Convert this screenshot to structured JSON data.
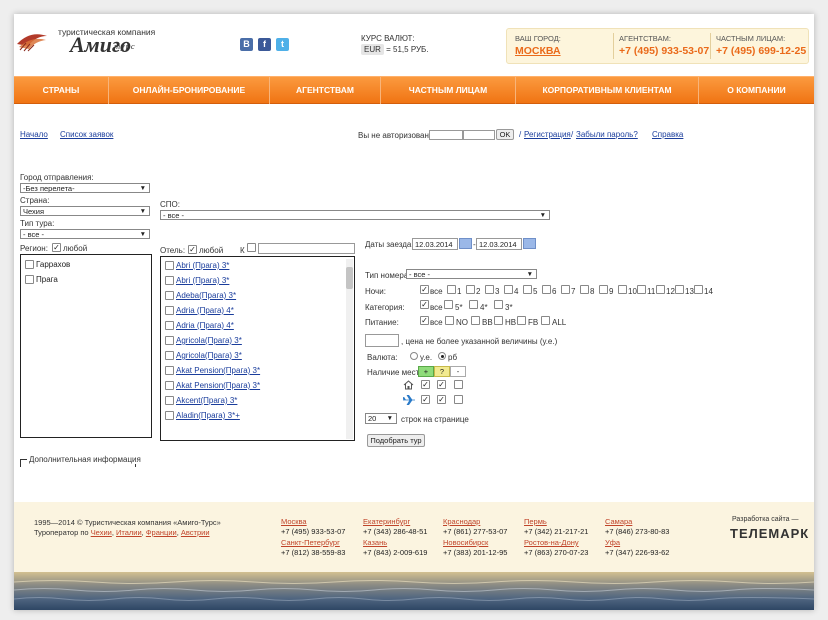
{
  "header": {
    "logo_top": "туристическая компания",
    "logo_main": "Амиго",
    "logo_sub": "турс",
    "social": [
      {
        "icon": "vk-icon",
        "text": "B",
        "color": "#4a6ea8"
      },
      {
        "icon": "facebook-icon",
        "text": "f",
        "color": "#3b5998"
      },
      {
        "icon": "twitter-icon",
        "text": "t",
        "color": "#4fb0e8"
      }
    ],
    "rate_title": "КУРС ВАЛЮТ:",
    "rate_currency": "EUR",
    "rate_value": "= 51,5 РУБ.",
    "city_label": "ВАШ ГОРОД:",
    "city_value": "МОСКВА",
    "agents_label": "АГЕНТСТВАМ:",
    "agents_phone": "+7 (495) 933-53-07",
    "private_label": "ЧАСТНЫМ ЛИЦАМ:",
    "private_phone": "+7 (495) 699-12-25"
  },
  "nav": [
    "СТРАНЫ",
    "ОНЛАЙН-БРОНИРОВАНИЕ",
    "АГЕНТСТВАМ",
    "ЧАСТНЫМ ЛИЦАМ",
    "КОРПОРАТИВНЫМ КЛИЕНТАМ",
    "О КОМПАНИИ"
  ],
  "links": {
    "home": "Начало",
    "orders": "Список заявок"
  },
  "login": {
    "not_auth": "Вы не авторизованы",
    "ok": "OK",
    "sep1": "/",
    "register": "Регистрация",
    "sep2": "/",
    "forgot": "Забыли пароль?",
    "help": "Справка"
  },
  "filters": {
    "departure_label": "Город отправления:",
    "departure_value": "-Без перелета-",
    "country_label": "Страна:",
    "country_value": "Чехия",
    "tour_type_label": "Тип тура:",
    "tour_type_value": "- все -",
    "region_label": "Регион:",
    "any": "любой",
    "regions": [
      "Гаррахов",
      "Прага"
    ],
    "spo_label": "СПО:",
    "spo_value": "- все -",
    "hotel_label": "Отель:",
    "hotel_prefix": "К"
  },
  "hotels": [
    "Abri (Прага) 3*",
    "Abri (Прага) 3*",
    "Adeba(Прага) 3*",
    "Adria (Прага) 4*",
    "Adria (Прага) 4*",
    "Agricola(Прага) 3*",
    "Agricola(Прага) 3*",
    "Akat Pension(Прага) 3*",
    "Akat Pension(Прага) 3*",
    "Akcent(Прага) 3*",
    "Aladin(Прага) 3*+"
  ],
  "search": {
    "dates_label": "Даты заезда:",
    "date_from": "12.03.2014",
    "date_dash": "-",
    "date_to": "12.03.2014",
    "room_type_label": "Тип номера:",
    "room_type_value": "- все -",
    "nights_label": "Ночи:",
    "all": "все",
    "nights": [
      "1",
      "2",
      "3",
      "4",
      "5",
      "6",
      "7",
      "8",
      "9",
      "10",
      "11",
      "12",
      "13",
      "14"
    ],
    "category_label": "Категория:",
    "categories": [
      "5*",
      "4*",
      "3*"
    ],
    "meals_label": "Питание:",
    "meals": [
      "NO",
      "BB",
      "HB",
      "FB",
      "ALL"
    ],
    "price_note": ", цена не более указанной величины (у.е.)",
    "currency_label": "Валюта:",
    "cur_ue": "у.е.",
    "cur_rub": "рб",
    "availability_label": "Наличие мест:",
    "avail_yes": "+",
    "avail_maybe": "?",
    "avail_no": "-",
    "rows_value": "20",
    "rows_label": "строк на странице",
    "submit": "Подобрать тур"
  },
  "extra_info": "Дополнительная информация",
  "footer": {
    "copyright": "1995—2014 © Туристическая компания «Амиго-Турс»",
    "operator_prefix": "Туроператор по",
    "operator_links": [
      "Чехии",
      "Италии",
      "Франции",
      "Австрии"
    ],
    "offices": [
      {
        "city": "Москва",
        "phone": "+7 (495) 933-53-07"
      },
      {
        "city": "Екатеринбург",
        "phone": "+7 (343) 286-48-51"
      },
      {
        "city": "Краснодар",
        "phone": "+7 (861) 277-53-07"
      },
      {
        "city": "Пермь",
        "phone": "+7 (342) 21-217-21"
      },
      {
        "city": "Самара",
        "phone": "+7 (846) 273-80-83"
      },
      {
        "city": "Санкт-Петербург",
        "phone": "+7 (812) 38-559-83"
      },
      {
        "city": "Казань",
        "phone": "+7 (843) 2-009-619"
      },
      {
        "city": "Новосибирск",
        "phone": "+7 (383) 201-12-95"
      },
      {
        "city": "Ростов-на-Дону",
        "phone": "+7 (863) 270-07-23"
      },
      {
        "city": "Уфа",
        "phone": "+7 (347) 226-93-62"
      }
    ],
    "dev_label": "Разработка сайта —",
    "dev_name": "ТЕЛЕМАРК"
  }
}
